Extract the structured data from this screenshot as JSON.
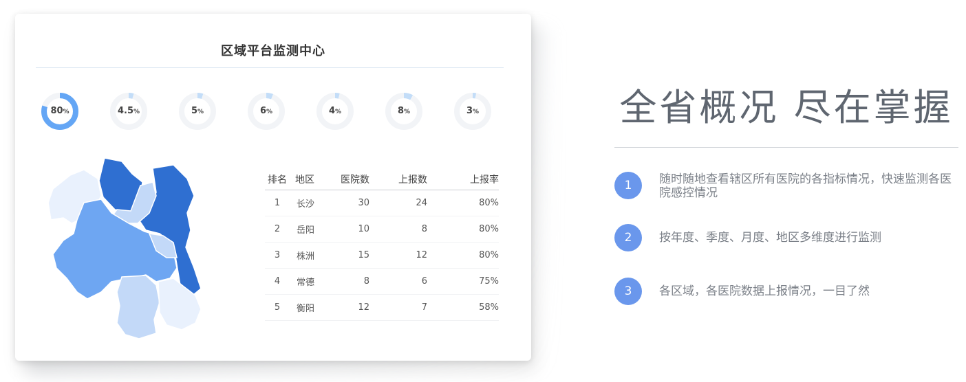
{
  "card": {
    "title": "区域平台监测中心",
    "gauges": [
      {
        "value": 80,
        "display": "80",
        "unit": "%"
      },
      {
        "value": 4.5,
        "display": "4.5",
        "unit": "%"
      },
      {
        "value": 5,
        "display": "5",
        "unit": "%"
      },
      {
        "value": 6,
        "display": "6",
        "unit": "%"
      },
      {
        "value": 4,
        "display": "4",
        "unit": "%"
      },
      {
        "value": 8,
        "display": "8",
        "unit": "%"
      },
      {
        "value": 3,
        "display": "3",
        "unit": "%"
      }
    ],
    "colors": {
      "gauge_high": "#64a6f5",
      "gauge_low": "#c3ddf8",
      "gauge_track": "#f2f4f7",
      "map_dark": "#2f6fd1",
      "map_mid": "#6ea6f2",
      "map_light": "#c3d9f8",
      "map_pale": "#e9f1fd"
    },
    "table": {
      "headers": [
        "排名",
        "地区",
        "医院数",
        "上报数",
        "上报率"
      ],
      "rows": [
        [
          "1",
          "长沙",
          "30",
          "24",
          "80%"
        ],
        [
          "2",
          "岳阳",
          "10",
          "8",
          "80%"
        ],
        [
          "3",
          "株洲",
          "15",
          "12",
          "80%"
        ],
        [
          "4",
          "常德",
          "8",
          "6",
          "75%"
        ],
        [
          "5",
          "衡阳",
          "12",
          "7",
          "58%"
        ]
      ]
    }
  },
  "right": {
    "headline": "全省概况 尽在掌握",
    "accent": "#6a97ec",
    "features": [
      {
        "num": "1",
        "text": "随时随地查看辖区所有医院的各指标情况，快速监测各医院感控情况"
      },
      {
        "num": "2",
        "text": "按年度、季度、月度、地区多维度进行监测"
      },
      {
        "num": "3",
        "text": "各区域，各医院数据上报情况，一目了然"
      }
    ]
  }
}
